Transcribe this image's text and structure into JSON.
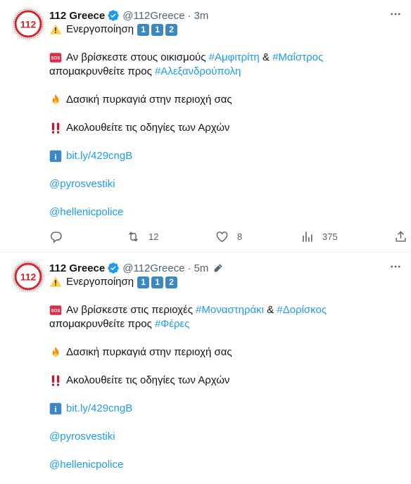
{
  "tweets": [
    {
      "name": "112 Greece",
      "handle": "@112Greece",
      "dot": "·",
      "time": "3m",
      "activation": "Ενεργοποίηση",
      "keys": [
        "1",
        "1",
        "2"
      ],
      "l1_pre": "Αν βρίσκεστε στους οικισμούς ",
      "l1_tag1": "#Αμφιτρίτη",
      "l1_amp": " & ",
      "l1_tag2": "#Μαΐστρος",
      "l2_pre": "απομακρυνθείτε προς ",
      "l2_tag": "#Αλεξανδρούπολη",
      "fire_text": "Δασική πυρκαγιά στην περιοχή σας",
      "warn_text": "Ακολουθείτε τις οδηγίες των Αρχών",
      "link": "bit.ly/429cngB",
      "mention1": "@pyrosvestiki",
      "mention2": "@hellenicpolice",
      "retweets": "12",
      "likes": "8",
      "views": "375"
    },
    {
      "name": "112 Greece",
      "handle": "@112Greece",
      "dot": "·",
      "time": "5m",
      "activation": "Ενεργοποίηση",
      "keys": [
        "1",
        "1",
        "2"
      ],
      "l1_pre": "Αν βρίσκεστε στις περιοχές ",
      "l1_tag1": "#Μοναστηράκι",
      "l1_amp": " & ",
      "l1_tag2": "#Δορίσκος",
      "l2_pre": "απομακρυνθείτε προς ",
      "l2_tag": "#Φέρες",
      "fire_text": "Δασική πυρκαγιά στην περιοχή σας",
      "warn_text": "Ακολουθείτε τις οδηγίες των Αρχών",
      "link": "bit.ly/429cngB",
      "mention1": "@pyrosvestiki",
      "mention2": "@hellenicpolice"
    }
  ],
  "avatar_text": "112",
  "sos_label": "SOS",
  "info_label": "i",
  "colors": {
    "link": "#1d9bf0",
    "secondary": "#536471",
    "avatar_red": "#d7242c",
    "key_blue": "#3b88c3",
    "verified": "#1d9bf0"
  },
  "icons": [
    "verified-badge-icon",
    "warning-icon",
    "sos-icon",
    "fire-icon",
    "double-exclamation-icon",
    "info-icon",
    "more-icon",
    "reply-icon",
    "retweet-icon",
    "like-icon",
    "views-icon",
    "share-icon",
    "edit-icon"
  ]
}
